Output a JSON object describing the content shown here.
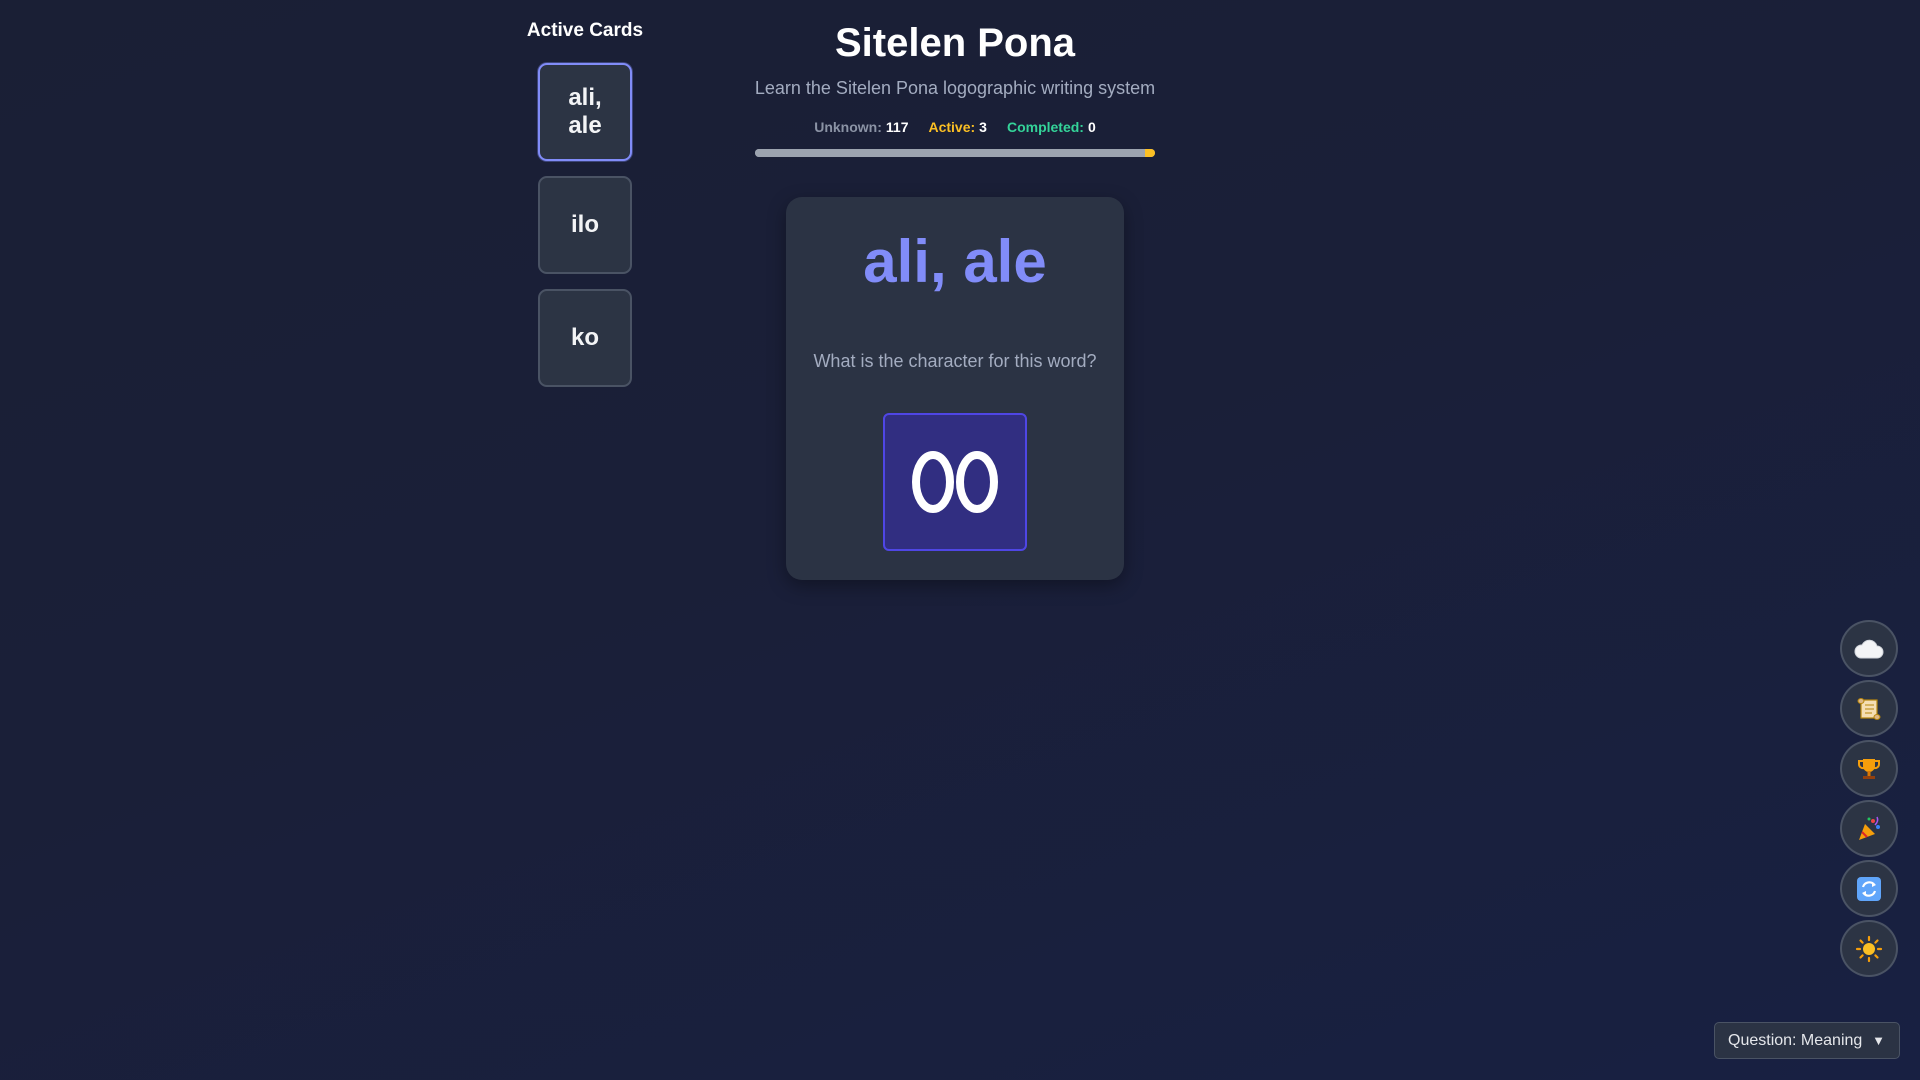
{
  "sidebar": {
    "title": "Active Cards",
    "cards": [
      {
        "label": "ali, ale",
        "selected": true
      },
      {
        "label": "ilo",
        "selected": false
      },
      {
        "label": "ko",
        "selected": false
      }
    ]
  },
  "header": {
    "title": "Sitelen Pona",
    "subtitle": "Learn the Sitelen Pona logographic writing system"
  },
  "stats": {
    "unknown_label": "Unknown:",
    "unknown_value": "117",
    "active_label": "Active:",
    "active_value": "3",
    "completed_label": "Completed:",
    "completed_value": "0"
  },
  "progress": {
    "unknown": 117,
    "active": 3,
    "completed": 0
  },
  "flashcard": {
    "word": "ali, ale",
    "question": "What is the character for this word?",
    "glyph_icon": "infinity-glyph-icon"
  },
  "fabs": [
    {
      "name": "cloud-sync-button",
      "icon": "cloud-icon"
    },
    {
      "name": "history-button",
      "icon": "scroll-icon"
    },
    {
      "name": "achievements-button",
      "icon": "trophy-icon"
    },
    {
      "name": "celebrate-button",
      "icon": "party-popper-icon"
    },
    {
      "name": "reset-button",
      "icon": "refresh-icon"
    },
    {
      "name": "theme-toggle-button",
      "icon": "sun-icon"
    }
  ],
  "question_mode": {
    "label": "Question: Meaning"
  },
  "colors": {
    "accent": "#818cf8",
    "active": "#fbbf24",
    "completed": "#34d399",
    "unknown": "#9ca3af",
    "glyph_bg": "#312e81"
  }
}
